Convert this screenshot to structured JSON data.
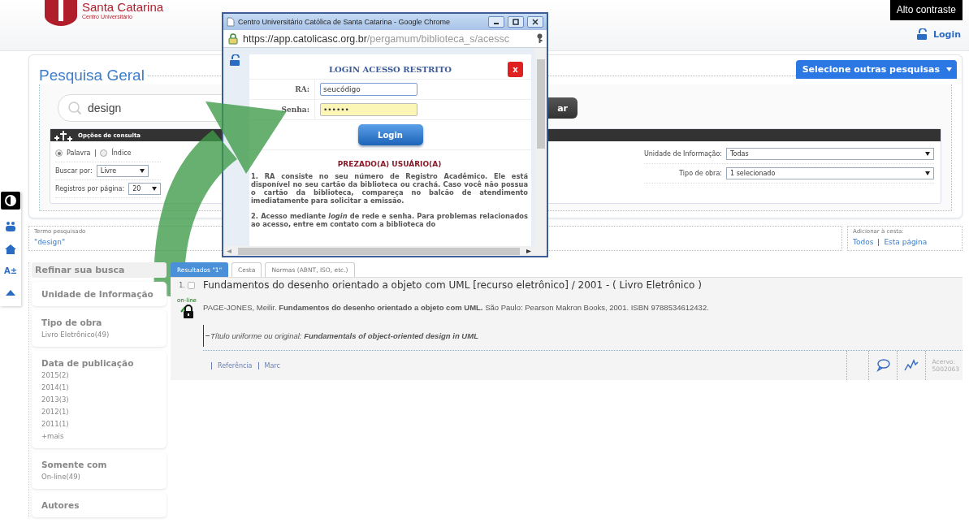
{
  "header": {
    "logo_name": "Santa Catarina",
    "logo_sub": "Centro Universitário",
    "contrast_button": "Alto contraste",
    "login_link": "Login"
  },
  "side_toolbar": {
    "font_size_label": "A±"
  },
  "search": {
    "title": "Pesquisa Geral",
    "query": "design",
    "button": "ar",
    "other_searches": "Selecione outras pesquisas"
  },
  "options": {
    "title": "Opções de consulta",
    "modes": [
      {
        "label": "Palavra",
        "selected": true
      },
      {
        "label": "Índice",
        "selected": false
      }
    ],
    "fields": [
      {
        "label": "Buscar por:",
        "value": "Livre"
      },
      {
        "label": "Registros por página:",
        "value": "20"
      }
    ],
    "filters": [
      {
        "label": "Unidade de Informação:",
        "value": "Todas"
      },
      {
        "label": "Tipo de obra:",
        "value": "1 selecionado"
      }
    ]
  },
  "term": {
    "legend": "Termo pesquisado",
    "value": "\"design\""
  },
  "basket": {
    "legend": "Adicionar à cesta:",
    "links": [
      "Todos",
      "Esta página"
    ]
  },
  "refine": {
    "title": "Refinar sua busca",
    "groups": [
      {
        "title": "Unidade de Informação"
      },
      {
        "title": "Tipo de obra",
        "items": [
          "Livro Eletrônico(49)"
        ]
      },
      {
        "title": "Data de publicação",
        "items": [
          "2015(2)",
          "2014(1)",
          "2013(3)",
          "2012(1)",
          "2011(1)",
          "+mais"
        ]
      },
      {
        "title": "Somente com",
        "items": [
          "On-line(49)"
        ]
      },
      {
        "title": "Autores"
      }
    ]
  },
  "tabs": [
    {
      "label": "Resultados \"1\"",
      "selected": true
    },
    {
      "label": "Cesta",
      "selected": false
    },
    {
      "label": "Normas (ABNT, ISO, etc.)",
      "selected": false
    }
  ],
  "results": [
    {
      "number": "1.",
      "checked": false,
      "title": "Fundamentos do desenho orientado a objeto com UML [recurso eletrônico] / 2001 -  ( Livro Eletrônico )",
      "citation": "PAGE-JONES, Meilir. **Fundamentos do desenho orientado a objeto com UML.** São Paulo: Pearson Makron Books, 2001. ISBN 9788534612432.",
      "access_label": "on-line",
      "uniform_title": "Título uniforme ou original: **Fundamentals of object-oriented design in UML**",
      "links": [
        "Referência",
        "Marc"
      ],
      "holding_label": "Acervo:",
      "holding": "5002063"
    }
  ],
  "popup": {
    "window_title": "Centro Universitário Católica de Santa Catarina - Google Chrome",
    "url_host": "https://app.catolicasc.org.br",
    "url_path": "/pergamum/biblioteca_s/acessc",
    "heading": "LOGIN ACESSO RESTRITO",
    "close": "x",
    "fields": [
      {
        "kind": "text",
        "label": "RA:",
        "value": "seucódigo"
      },
      {
        "kind": "password",
        "label": "Senha:",
        "value": "••••••"
      }
    ],
    "button": "Login",
    "notice_title": "PREZADO(A) USUÁRIO(A)",
    "paragraphs": [
      "1. RA consiste no seu número de Registro Acadêmico. Ele está disponível no seu cartão da biblioteca ou crachá. Caso você não possua o cartão da biblioteca, compareça no balcão de atendimento imediatamente para solicitar a emissão.",
      "2. Acesso mediante *login* de rede e senha. Para problemas relacionados ao acesso, entre em contato com a biblioteca do"
    ]
  }
}
